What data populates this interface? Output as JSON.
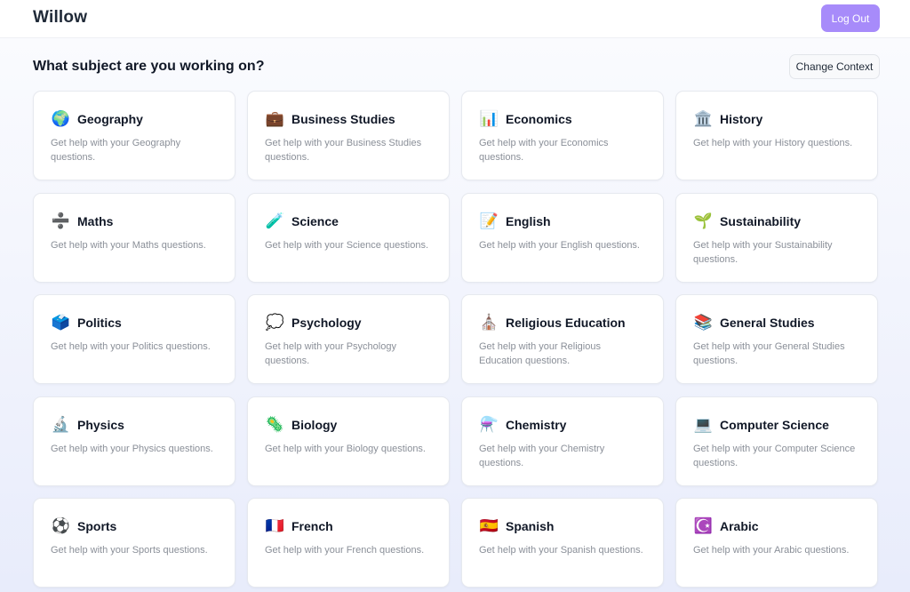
{
  "header": {
    "brand": "Willow",
    "logout_label": "Log Out"
  },
  "main": {
    "heading": "What subject are you working on?",
    "change_context_label": "Change Context",
    "subjects": [
      {
        "title": "Geography",
        "icon": "🌍",
        "icon_name": "globe-icon",
        "desc": "Get help with your Geography questions."
      },
      {
        "title": "Business Studies",
        "icon": "💼",
        "icon_name": "briefcase-icon",
        "desc": "Get help with your Business Studies questions."
      },
      {
        "title": "Economics",
        "icon": "📊",
        "icon_name": "bar-chart-icon",
        "desc": "Get help with your Economics questions."
      },
      {
        "title": "History",
        "icon": "🏛️",
        "icon_name": "classical-building-icon",
        "desc": "Get help with your History questions."
      },
      {
        "title": "Maths",
        "icon": "➗",
        "icon_name": "divide-icon",
        "desc": "Get help with your Maths questions."
      },
      {
        "title": "Science",
        "icon": "🧪",
        "icon_name": "test-tube-icon",
        "desc": "Get help with your Science questions."
      },
      {
        "title": "English",
        "icon": "📝",
        "icon_name": "memo-icon",
        "desc": "Get help with your English questions."
      },
      {
        "title": "Sustainability",
        "icon": "🌱",
        "icon_name": "seedling-icon",
        "desc": "Get help with your Sustainability questions."
      },
      {
        "title": "Politics",
        "icon": "🗳️",
        "icon_name": "ballot-box-icon",
        "desc": "Get help with your Politics questions."
      },
      {
        "title": "Psychology",
        "icon": "💭",
        "icon_name": "thought-bubble-icon",
        "desc": "Get help with your Psychology questions."
      },
      {
        "title": "Religious Education",
        "icon": "⛪",
        "icon_name": "church-icon",
        "desc": "Get help with your Religious Education questions."
      },
      {
        "title": "General Studies",
        "icon": "📚",
        "icon_name": "books-icon",
        "desc": "Get help with your General Studies questions."
      },
      {
        "title": "Physics",
        "icon": "🔬",
        "icon_name": "microscope-icon",
        "desc": "Get help with your Physics questions."
      },
      {
        "title": "Biology",
        "icon": "🦠",
        "icon_name": "microbe-icon",
        "desc": "Get help with your Biology questions."
      },
      {
        "title": "Chemistry",
        "icon": "⚗️",
        "icon_name": "alembic-icon",
        "desc": "Get help with your Chemistry questions."
      },
      {
        "title": "Computer Science",
        "icon": "💻",
        "icon_name": "laptop-icon",
        "desc": "Get help with your Computer Science questions."
      },
      {
        "title": "Sports",
        "icon": "⚽",
        "icon_name": "soccer-ball-icon",
        "desc": "Get help with your Sports questions."
      },
      {
        "title": "French",
        "icon": "🇫🇷",
        "icon_name": "french-flag-icon",
        "desc": "Get help with your French questions."
      },
      {
        "title": "Spanish",
        "icon": "🇪🇸",
        "icon_name": "spanish-flag-icon",
        "desc": "Get help with your Spanish questions."
      },
      {
        "title": "Arabic",
        "icon": "☪️",
        "icon_name": "star-and-crescent-icon",
        "desc": "Get help with your Arabic questions."
      }
    ]
  },
  "colors": {
    "accent": "#a78bfa",
    "title_text": "#111827",
    "muted_text": "#8a8f98",
    "card_border": "#e6e9ef"
  }
}
